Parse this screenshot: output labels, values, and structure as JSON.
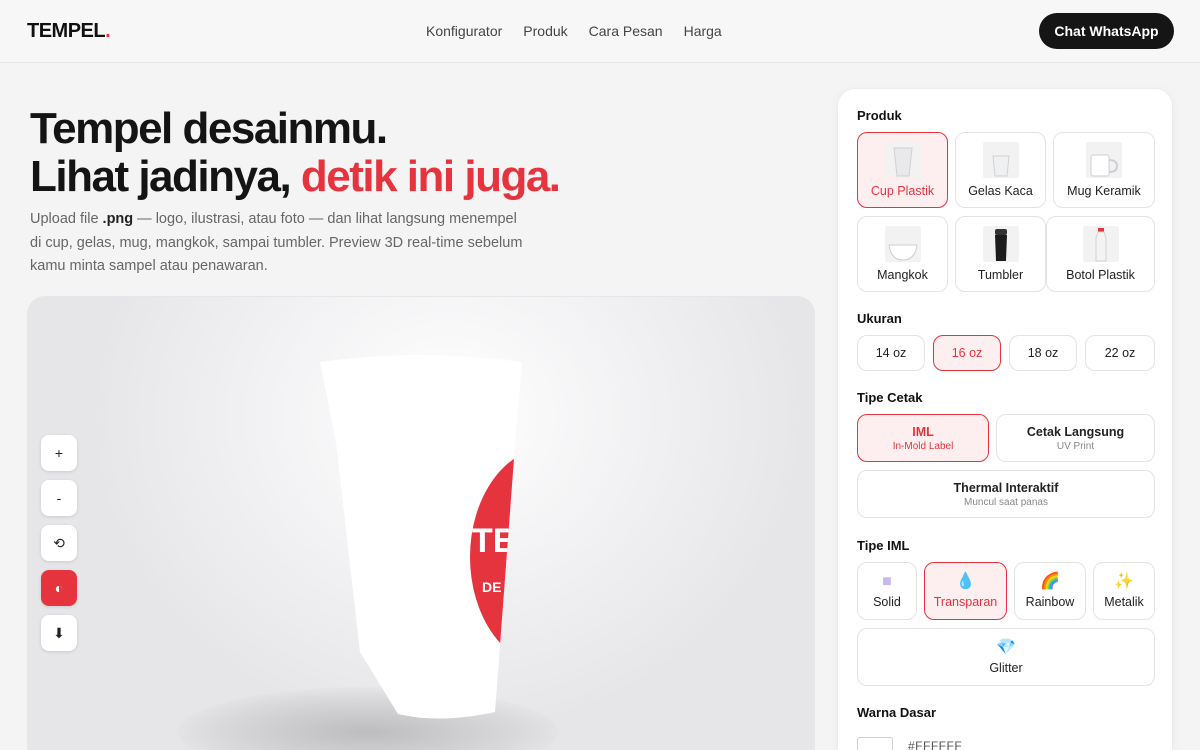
{
  "nav": {
    "logo": "TEMPEL",
    "logo_dot": ".",
    "links": [
      "Konfigurator",
      "Produk",
      "Cara Pesan",
      "Harga"
    ],
    "cta": "Chat WhatsApp"
  },
  "hero": {
    "line1": "Tempel desainmu.",
    "line2_a": "Lihat jadinya, ",
    "line2_b": "detik ini juga.",
    "sub_a": "Upload file ",
    "sub_b": ".png",
    "sub_c": " — logo, ilustrasi, atau foto — dan lihat langsung menempel di cup, gelas, mug, mangkok, sampai tumbler. Preview 3D real-time sebelum kamu minta sampel atau penawaran."
  },
  "viewer": {
    "cup_print": "TE",
    "cup_print_sub": "DE",
    "tools": [
      {
        "label": "+",
        "name": "zoom-in-button"
      },
      {
        "label": "-",
        "name": "zoom-out-button"
      },
      {
        "label": "⟲",
        "name": "reset-view-button"
      },
      {
        "label": "◐",
        "name": "contrast-toggle-button"
      },
      {
        "label": "⬇",
        "name": "download-button"
      }
    ],
    "active_tool": 3
  },
  "panel": {
    "produk_label": "Produk",
    "produk": [
      {
        "label": "Cup Plastik",
        "icon": "plastic-cup-icon",
        "selected": true
      },
      {
        "label": "Gelas Kaca",
        "icon": "glass-icon",
        "selected": false
      },
      {
        "label": "Mug Keramik",
        "icon": "mug-icon",
        "selected": false
      },
      {
        "label": "Mangkok",
        "icon": "bowl-icon",
        "selected": false
      },
      {
        "label": "Tumbler",
        "icon": "tumbler-icon",
        "selected": false
      },
      {
        "label": "Botol Plastik",
        "icon": "bottle-icon",
        "selected": false
      }
    ],
    "ukuran_label": "Ukuran",
    "ukuran": [
      "14 oz",
      "16 oz",
      "18 oz",
      "22 oz"
    ],
    "ukuran_selected": 1,
    "tipe_cetak_label": "Tipe Cetak",
    "tipe_cetak": [
      {
        "title": "IML",
        "sub": "In-Mold Label",
        "selected": true
      },
      {
        "title": "Cetak Langsung",
        "sub": "UV Print",
        "selected": false
      },
      {
        "title": "Thermal Interaktif",
        "sub": "Muncul saat panas",
        "selected": false
      }
    ],
    "tipe_iml_label": "Tipe IML",
    "tipe_iml": [
      {
        "label": "Solid",
        "icon": "square-swatch-icon",
        "glyph": "■",
        "color": "#c9b8f0",
        "selected": false
      },
      {
        "label": "Transparan",
        "icon": "droplet-icon",
        "glyph": "💧",
        "color": "#3aa0e8",
        "selected": true
      },
      {
        "label": "Rainbow",
        "icon": "rainbow-icon",
        "glyph": "🌈",
        "color": "#e5343e",
        "selected": false
      },
      {
        "label": "Metalik",
        "icon": "sparkles-icon",
        "glyph": "✨",
        "color": "#e8b52a",
        "selected": false
      },
      {
        "label": "Glitter",
        "icon": "gem-icon",
        "glyph": "💎",
        "color": "#3aa0e8",
        "selected": false
      }
    ],
    "warna_label": "Warna Dasar",
    "warna_hex": "#FFFFFF"
  },
  "colors": {
    "accent": "#e5343e",
    "dark": "#151515"
  }
}
